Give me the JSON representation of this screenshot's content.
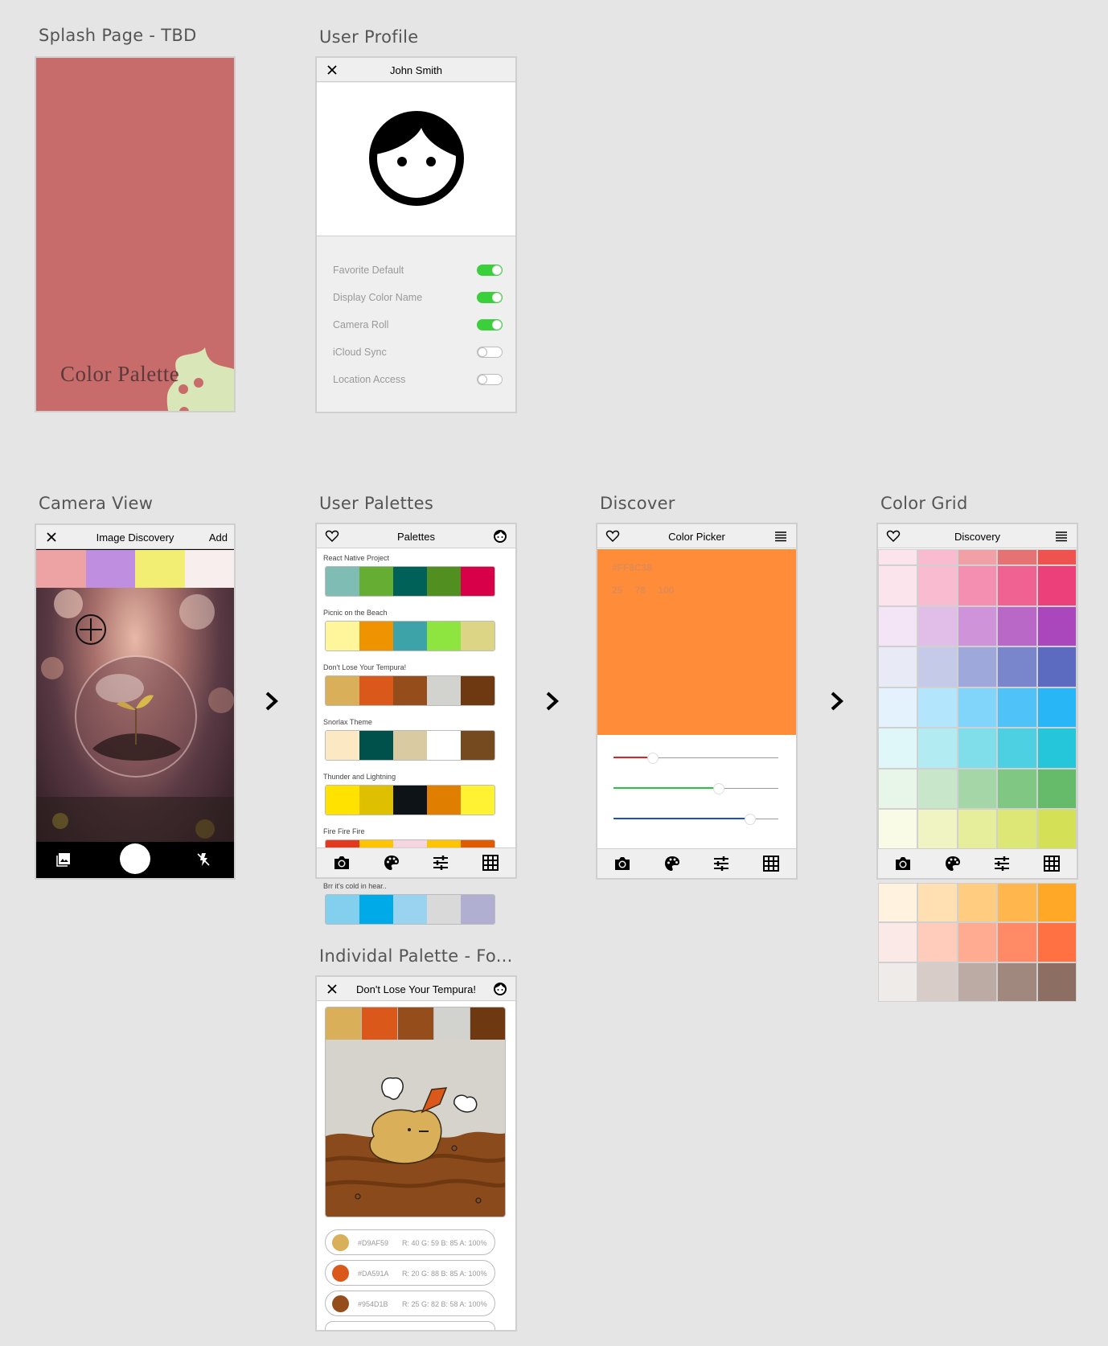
{
  "artboards": {
    "splash": "Splash Page - TBD",
    "profile": "User Profile",
    "camera": "Camera View",
    "palettes": "User Palettes",
    "discover": "Discover",
    "grid": "Color Grid",
    "individual": "Individal Palette - Fo..."
  },
  "splash": {
    "logo_text": "Color Palette",
    "bg": "#c86b6b",
    "palette_color": "#d9e7b8"
  },
  "profile": {
    "title": "John Smith",
    "settings": [
      {
        "label": "Favorite Default",
        "on": true
      },
      {
        "label": "Display Color Name",
        "on": true
      },
      {
        "label": "Camera Roll",
        "on": true
      },
      {
        "label": "iCloud Sync",
        "on": false
      },
      {
        "label": "Location Access",
        "on": false
      }
    ]
  },
  "camera": {
    "title": "Image Discovery",
    "add_label": "Add",
    "swatches": [
      "#eda3a3",
      "#bf8ee0",
      "#f2ee73",
      "#f8eeee"
    ]
  },
  "palettes": {
    "title": "Palettes",
    "items": [
      {
        "name": "React Native Project",
        "colors": [
          "#7fbdb4",
          "#66ad33",
          "#006158",
          "#528f21",
          "#d9004a"
        ]
      },
      {
        "name": "Picnic on the Beach",
        "colors": [
          "#fff59a",
          "#ef9400",
          "#3ea3a8",
          "#8ee53f",
          "#dcd585"
        ]
      },
      {
        "name": "Don't Lose Your Tempura!",
        "colors": [
          "#d9af59",
          "#da591a",
          "#954d1b",
          "#d2d2cf",
          "#6e3811"
        ]
      },
      {
        "name": "Snorlax Theme",
        "colors": [
          "#fce8c3",
          "#00504c",
          "#dacaa2",
          "#ffffff",
          "#744a1e"
        ]
      },
      {
        "name": "Thunder and Lightning",
        "colors": [
          "#ffe200",
          "#dfc000",
          "#0d1317",
          "#e07e00",
          "#fff233"
        ]
      },
      {
        "name": "Fire Fire Fire",
        "colors": [
          "#e23a1e",
          "#ffc400",
          "#f5d6e0",
          "#ffc400",
          "#e05a00"
        ]
      }
    ],
    "overflow": {
      "name": "Brr it's cold in hear..",
      "colors": [
        "#82cfee",
        "#00aae8",
        "#99d3ef",
        "#d9d9d9",
        "#b0aed1"
      ]
    }
  },
  "discover": {
    "title": "Color Picker",
    "hex": "#FF8C38",
    "rgb": [
      "25",
      "78",
      "100"
    ],
    "color": "#fe8c38",
    "sliders": [
      {
        "color": "#e52020",
        "value": 0.24
      },
      {
        "color": "#20c840",
        "value": 0.64
      },
      {
        "color": "#1a4fd0",
        "value": 0.83
      }
    ]
  },
  "grid": {
    "title": "Discovery",
    "rows": [
      [
        "#fce4ec",
        "#f8bbd0",
        "#f1a0a6",
        "#e57373",
        "#ef5350"
      ],
      [
        "#fce4ec",
        "#f8bbd0",
        "#f48fb1",
        "#f06292",
        "#ec407a"
      ],
      [
        "#f3e5f5",
        "#e1bee7",
        "#ce93d8",
        "#ba68c8",
        "#ab47bc"
      ],
      [
        "#e8eaf6",
        "#c5cae9",
        "#9fa8da",
        "#7986cb",
        "#5c6bc0"
      ],
      [
        "#e3f2fd",
        "#b3e5fc",
        "#81d4fa",
        "#4fc3f7",
        "#29b6f6"
      ],
      [
        "#e0f7fa",
        "#b2ebf2",
        "#80deea",
        "#4dd0e1",
        "#26c6da"
      ],
      [
        "#e8f5e9",
        "#c8e6c9",
        "#a5d6a7",
        "#81c784",
        "#66bb6a"
      ],
      [
        "#f9fbe7",
        "#f0f4c3",
        "#e6ee9c",
        "#dce775",
        "#d4e157"
      ]
    ],
    "overflow_rows": [
      [
        "#fff3e0",
        "#ffe0b2",
        "#ffcc80",
        "#ffb74d",
        "#ffa726"
      ],
      [
        "#fbe9e7",
        "#ffccbc",
        "#ffab91",
        "#ff8a65",
        "#ff7043"
      ],
      [
        "#efebe9",
        "#d7ccc8",
        "#bcaaa4",
        "#a1887f",
        "#8d6e63"
      ]
    ]
  },
  "individual": {
    "title": "Don't Lose Your Tempura!",
    "colors": [
      "#d9af59",
      "#da591a",
      "#954d1b",
      "#d2d2cf",
      "#6e3811"
    ],
    "entries": [
      {
        "hex": "#D9AF59",
        "vals": "R: 40  G: 59  B: 85  A:  100%",
        "color": "#d9af59"
      },
      {
        "hex": "#DA591A",
        "vals": "R: 20  G: 88  B: 85  A:  100%",
        "color": "#da591a"
      },
      {
        "hex": "#954D1B",
        "vals": "R: 25  G: 82  B: 58  A:  100%",
        "color": "#954d1b"
      }
    ]
  }
}
